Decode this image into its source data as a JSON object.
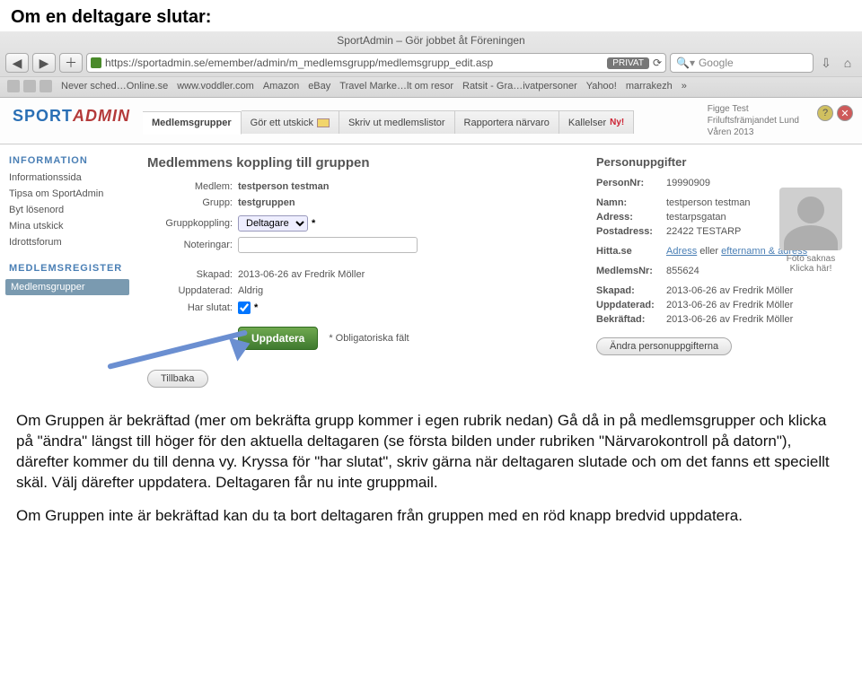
{
  "heading": "Om en deltagare slutar:",
  "browser": {
    "title": "SportAdmin – Gör jobbet åt Föreningen",
    "url": "https://sportadmin.se/emember/admin/m_medlemsgrupp/medlemsgrupp_edit.asp",
    "privat_badge": "PRIVAT",
    "reload": "⟳",
    "search_placeholder": "Google",
    "bookmarks": [
      "Never sched…Online.se",
      "www.voddler.com",
      "Amazon",
      "eBay",
      "Travel Marke…lt om resor",
      "Ratsit - Gra…ivatpersoner",
      "Yahoo!",
      "marrakezh"
    ]
  },
  "logo": {
    "part1": "SPORT",
    "part2": "ADMIN"
  },
  "tabs": [
    {
      "label": "Medlemsgrupper",
      "active": true
    },
    {
      "label": "Gör ett utskick"
    },
    {
      "label": "Skriv ut medlemslistor"
    },
    {
      "label": "Rapportera närvaro"
    },
    {
      "label": "Kallelser",
      "ny": "Ny!"
    }
  ],
  "header_meta": {
    "line1": "Figge Test",
    "line2": "Friluftsfrämjandet Lund",
    "line3": "Våren 2013"
  },
  "sidebar": {
    "h1": "INFORMATION",
    "items1": [
      "Informationssida",
      "Tipsa om SportAdmin",
      "Byt lösenord",
      "Mina utskick",
      "Idrottsforum"
    ],
    "h2": "MEDLEMSREGISTER",
    "active_item": "Medlemsgrupper"
  },
  "main": {
    "title": "Medlemmens koppling till gruppen",
    "medlem_label": "Medlem:",
    "medlem_val": "testperson testman",
    "grupp_label": "Grupp:",
    "grupp_val": "testgruppen",
    "koppling_label": "Gruppkoppling:",
    "koppling_val": "Deltagare",
    "noteringar_label": "Noteringar:",
    "noteringar_val": "",
    "skapad_label": "Skapad:",
    "skapad_val": "2013-06-26 av Fredrik Möller",
    "uppdaterad_label": "Uppdaterad:",
    "uppdaterad_val": "Aldrig",
    "har_slutat_label": "Har slutat:",
    "update_btn": "Uppdatera",
    "mandatory": "* Obligatoriska fält",
    "tillbaka": "Tillbaka"
  },
  "right": {
    "title": "Personuppgifter",
    "personnr_l": "PersonNr:",
    "personnr_v": "19990909",
    "namn_l": "Namn:",
    "namn_v": "testperson testman",
    "adress_l": "Adress:",
    "adress_v": "testarpsgatan",
    "post_l": "Postadress:",
    "post_v": "22422 TESTARP",
    "hitta_l": "Hitta.se",
    "hitta_adress": "Adress",
    "hitta_eller": " eller ",
    "hitta_eft": "efternamn & adress",
    "medlemsnr_l": "MedlemsNr:",
    "medlemsnr_v": "855624",
    "skapad_l": "Skapad:",
    "skapad_v": "2013-06-26 av Fredrik Möller",
    "uppdat_l": "Uppdaterad:",
    "uppdat_v": "2013-06-26 av Fredrik Möller",
    "bekraft_l": "Bekräftad:",
    "bekraft_v": "2013-06-26 av Fredrik Möller",
    "andra_btn": "Ändra personuppgifterna",
    "avatar_l1": "Foto saknas",
    "avatar_l2": "Klicka här!"
  },
  "body_paragraphs": [
    "Om Gruppen är bekräftad (mer om bekräfta grupp kommer i egen rubrik nedan) Gå då in på medlemsgrupper och klicka på \"ändra\" längst till höger för den aktuella deltagaren (se första bilden under rubriken \"Närvarokontroll på datorn\"), därefter kommer du till denna vy. Kryssa för \"har slutat\", skriv gärna när deltagaren slutade och om det fanns ett speciellt skäl. Välj därefter uppdatera. Deltagaren får nu inte gruppmail.",
    "Om Gruppen inte är bekräftad kan du ta bort deltagaren från gruppen med en röd knapp bredvid uppdatera."
  ]
}
